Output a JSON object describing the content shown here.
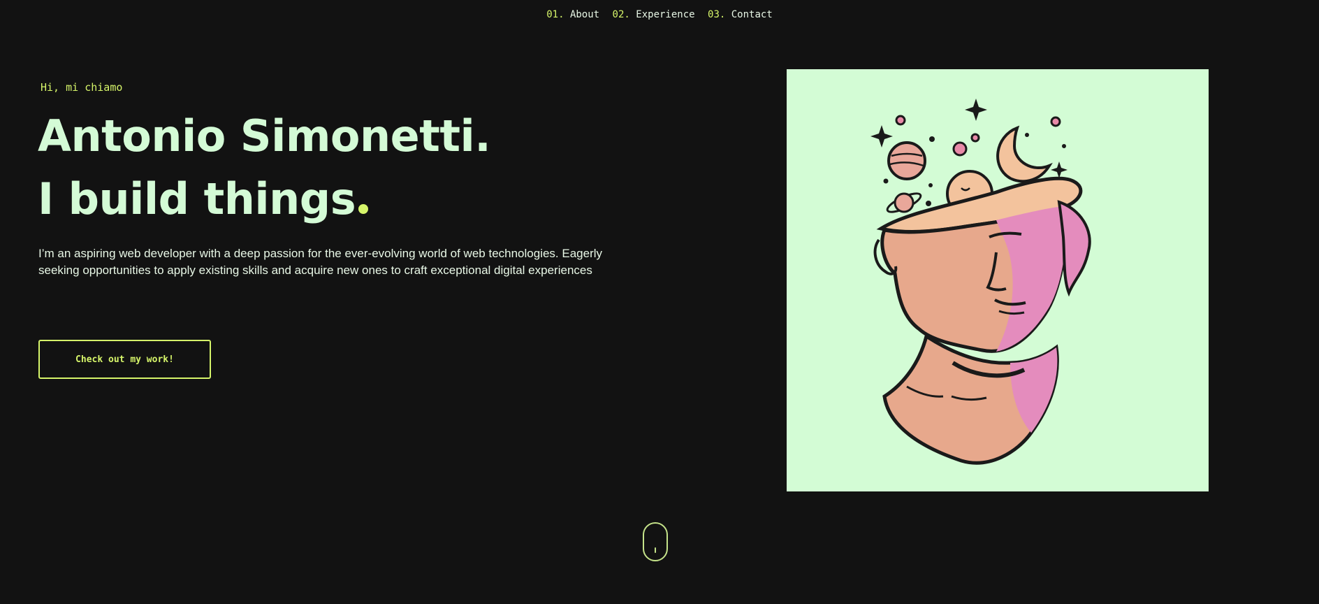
{
  "nav": {
    "items": [
      {
        "number": "01.",
        "label": "About"
      },
      {
        "number": "02.",
        "label": "Experience"
      },
      {
        "number": "03.",
        "label": "Contact"
      }
    ]
  },
  "hero": {
    "greeting": "Hi, mi chiamo",
    "name": "Antonio Simonetti.",
    "tagline": "I build things",
    "intro": "I’m an aspiring web developer with a deep passion for the ever-evolving world of web technologies. Eagerly seeking opportunities to apply existing skills and acquire new ones to craft exceptional digital experiences",
    "cta_label": "Check out my work!"
  },
  "image": {
    "subject": "illustration of a classical bust with an open head releasing planets, stars and a crescent moon"
  },
  "colors": {
    "background": "#121212",
    "accent": "#d6f56a",
    "text": "#d4fbd6",
    "image_background": "#d3fcd5"
  },
  "icons": {
    "scroll": "mouse-scroll-icon"
  }
}
